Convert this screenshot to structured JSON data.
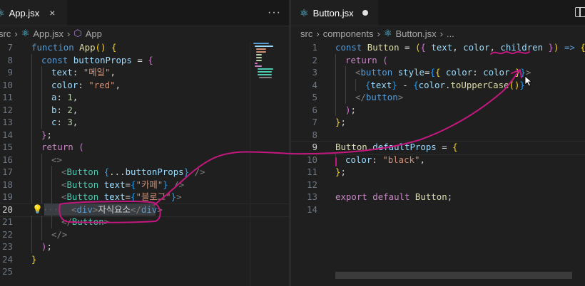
{
  "left_editor": {
    "tab": {
      "filename": "App.jsx",
      "close_glyph": "×"
    },
    "more_glyph": "···",
    "breadcrumb": {
      "folder": "src",
      "file": "App.jsx",
      "symbol": "App"
    },
    "line_numbers": [
      "7",
      "8",
      "9",
      "10",
      "11",
      "12",
      "13",
      "14",
      "15",
      "16",
      "17",
      "18",
      "19",
      "20",
      "21",
      "22",
      "23",
      "24",
      "25"
    ],
    "active_line": "20"
  },
  "right_editor": {
    "tab": {
      "filename": "Button.jsx",
      "modified": true
    },
    "breadcrumb": {
      "folder1": "src",
      "folder2": "components",
      "file": "Button.jsx",
      "more": "..."
    },
    "line_numbers": [
      "1",
      "2",
      "3",
      "4",
      "5",
      "6",
      "7",
      "8",
      "9",
      "10",
      "11",
      "12",
      "13",
      "14"
    ],
    "active_line": "9"
  },
  "colors": {
    "background": "#1f1f1f",
    "tabbar": "#181818",
    "annotation_ink": "#c2187f",
    "react_icon": "#61dafb"
  },
  "icons": {
    "react": "react-icon",
    "symbol": "cube-icon",
    "lightbulb": "lightbulb-icon",
    "split": "split-editor-icon",
    "mouse": "mouse-cursor-icon"
  }
}
